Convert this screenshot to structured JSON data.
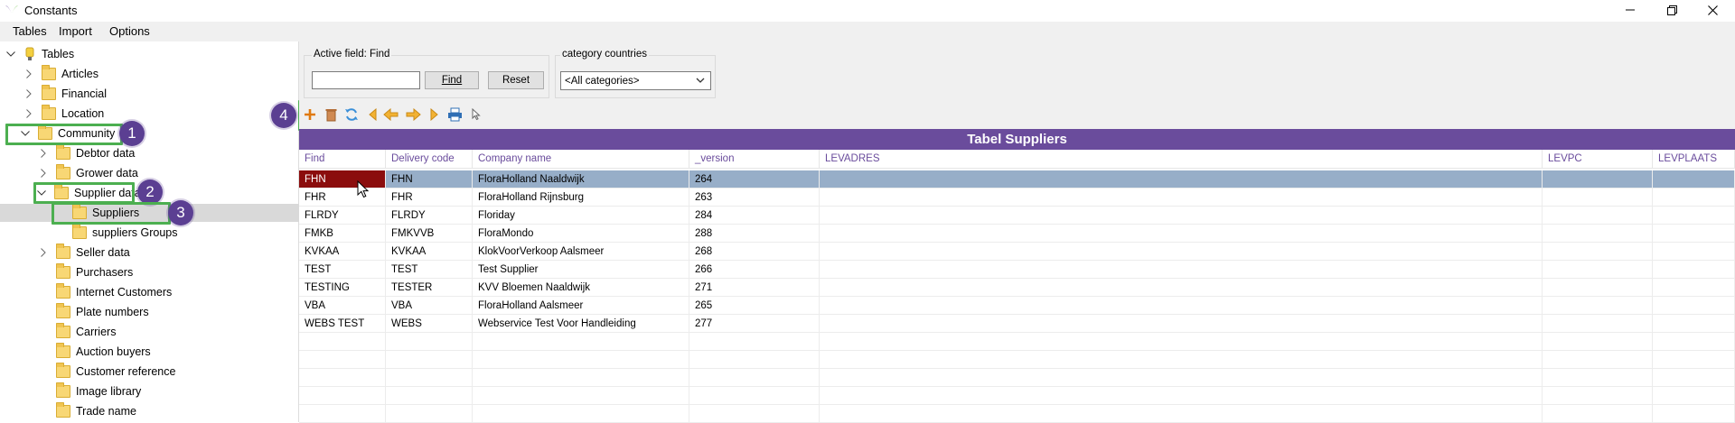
{
  "window": {
    "title": "Constants"
  },
  "menu": {
    "tables": "Tables",
    "import": "Import",
    "options": "Options"
  },
  "tree": {
    "root": "Tables",
    "articles": "Articles",
    "financial": "Financial",
    "location": "Location",
    "community": "Community",
    "debtor_data": "Debtor data",
    "grower_data": "Grower data",
    "supplier_data": "Supplier data",
    "suppliers": "Suppliers",
    "suppliers_groups": "suppliers Groups",
    "seller_data": "Seller data",
    "purchasers": "Purchasers",
    "internet_customers": "Internet Customers",
    "plate_numbers": "Plate numbers",
    "carriers": "Carriers",
    "auction_buyers": "Auction buyers",
    "customer_reference": "Customer reference",
    "image_library": "Image library",
    "trade_name": "Trade name"
  },
  "callouts": {
    "one": "1",
    "two": "2",
    "three": "3",
    "four": "4"
  },
  "search": {
    "group_label": "Active field: Find",
    "input_value": "",
    "find_label": "Find",
    "reset_label": "Reset"
  },
  "category": {
    "group_label": "category countries",
    "selected": "<All categories>"
  },
  "toolbar": {
    "icons": [
      "plus-icon",
      "trash-icon",
      "refresh-icon",
      "first-icon",
      "prev-icon",
      "next-icon",
      "last-icon",
      "print-icon",
      "pointer-icon"
    ]
  },
  "grid": {
    "title": "Tabel Suppliers",
    "columns": [
      "Find",
      "Delivery code",
      "Company name",
      "_version",
      "LEVADRES",
      "LEVPC",
      "LEVPLAATS"
    ],
    "rows": [
      [
        "FHN",
        "FHN",
        "FloraHolland Naaldwijk",
        "264",
        "",
        "",
        ""
      ],
      [
        "FHR",
        "FHR",
        "FloraHolland Rijnsburg",
        "263",
        "",
        "",
        ""
      ],
      [
        "FLRDY",
        "FLRDY",
        "Floriday",
        "284",
        "",
        "",
        ""
      ],
      [
        "FMKB",
        "FMKVVB",
        "FloraMondo",
        "288",
        "",
        "",
        ""
      ],
      [
        "KVKAA",
        "KVKAA",
        "KlokVoorVerkoop Aalsmeer",
        "268",
        "",
        "",
        ""
      ],
      [
        "TEST",
        "TEST",
        "Test Supplier",
        "266",
        "",
        "",
        ""
      ],
      [
        "TESTING",
        "TESTER",
        "KVV Bloemen Naaldwijk",
        "271",
        "",
        "",
        ""
      ],
      [
        "VBA",
        "VBA",
        "FloraHolland Aalsmeer",
        "265",
        "",
        "",
        ""
      ],
      [
        "WEBS TEST",
        "WEBS",
        "Webservice Test Voor Handleiding",
        "277",
        "",
        "",
        ""
      ]
    ]
  },
  "colors": {
    "accent": "#6a4c9c",
    "selected_cell": "#8b0d0d",
    "selected_row": "#97aec8",
    "highlight": "#4caf50"
  }
}
